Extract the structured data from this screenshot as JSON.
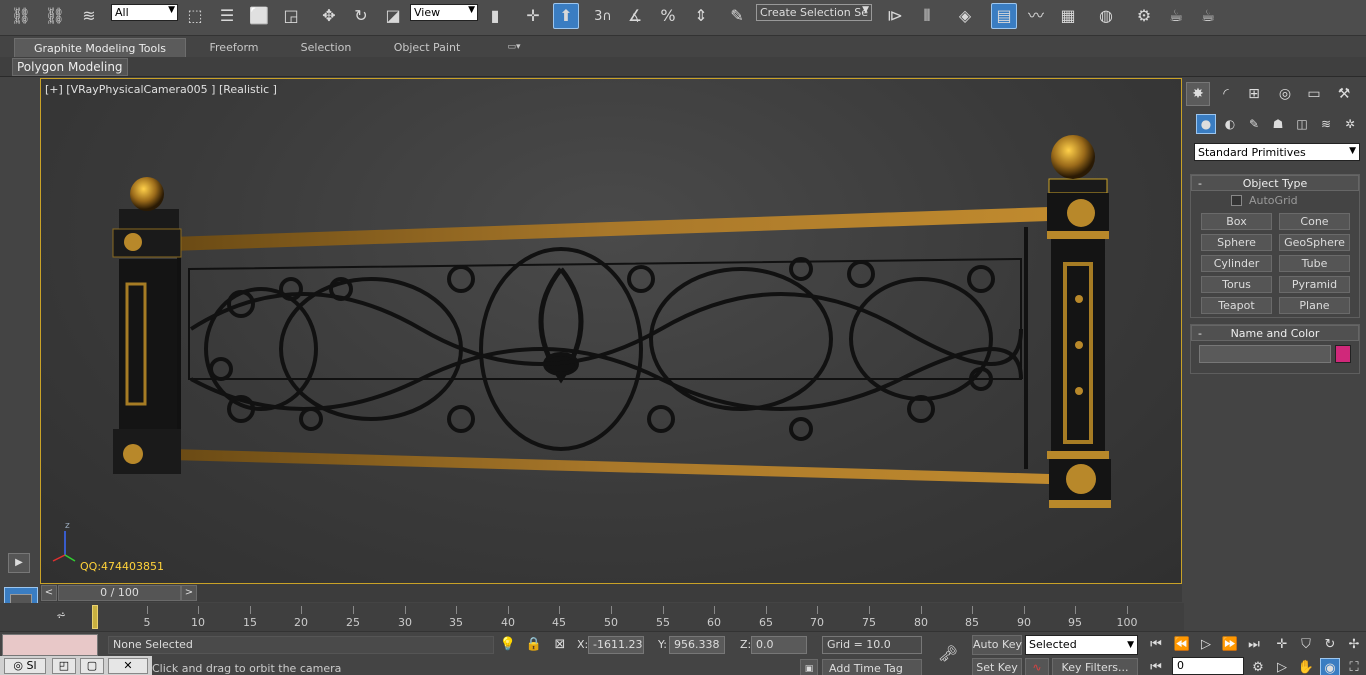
{
  "toolbar": {
    "filter_value": "All",
    "ref_coord_value": "View",
    "selection_set_placeholder": "Create Selection Se",
    "icons": [
      "link-icon",
      "unlink-icon",
      "bind-spacewarp-icon",
      "select-object-icon",
      "select-by-name-icon",
      "rect-region-icon",
      "window-crossing-icon",
      "move-icon",
      "rotate-icon",
      "scale-icon",
      "pivot-icon",
      "select-manipulate-icon",
      "keyboard-shortcut-icon",
      "snaps-toggle-icon",
      "angle-snap-icon",
      "percent-snap-icon",
      "spinner-snap-icon",
      "edit-named-sets-icon",
      "mirror-icon",
      "align-icon",
      "layer-manager-icon",
      "graphite-toggle-icon",
      "curve-editor-icon",
      "schematic-view-icon",
      "material-editor-icon",
      "render-setup-icon",
      "rendered-frame-icon",
      "render-icon"
    ]
  },
  "ribbon": {
    "tabs": [
      "Graphite Modeling Tools",
      "Freeform",
      "Selection",
      "Object Paint"
    ],
    "active_tab": "Graphite Modeling Tools",
    "panel_button": "Polygon Modeling"
  },
  "viewport": {
    "label": "[+] [VRayPhysicalCamera005 ] [Realistic ]",
    "watermark": "QQ:474403851",
    "axis_z": "z",
    "frame_color": "#c9a227"
  },
  "command_panel": {
    "category_value": "Standard Primitives",
    "object_type_title": "Object Type",
    "autogrid_label": "AutoGrid",
    "object_buttons": [
      "Box",
      "Cone",
      "Sphere",
      "GeoSphere",
      "Cylinder",
      "Tube",
      "Torus",
      "Pyramid",
      "Teapot",
      "Plane"
    ],
    "name_color_title": "Name and Color",
    "object_color": "#d0287a"
  },
  "timeline": {
    "frame_display": "0 / 100",
    "prev": "<",
    "next": ">",
    "ticks": [
      "0",
      "5",
      "10",
      "15",
      "20",
      "25",
      "30",
      "35",
      "40",
      "45",
      "50",
      "55",
      "60",
      "65",
      "70",
      "75",
      "80",
      "85",
      "90",
      "95",
      "100"
    ]
  },
  "status": {
    "selection_text": "None Selected",
    "prompt_text": "Click and drag to orbit the camera",
    "x_label": "X:",
    "x_value": "-1611.231",
    "y_label": "Y:",
    "y_value": "956.338",
    "z_label": "Z:",
    "z_value": "0.0",
    "grid_text": "Grid = 10.0",
    "add_time_tag": "Add Time Tag",
    "auto_key": "Auto Key",
    "set_key": "Set Key",
    "key_mode_value": "Selected",
    "key_filters": "Key Filters...",
    "current_frame": "0",
    "taskbar_item": "Sl"
  },
  "colors": {
    "accent": "#3a7dc2",
    "gold": "#c9a227"
  }
}
